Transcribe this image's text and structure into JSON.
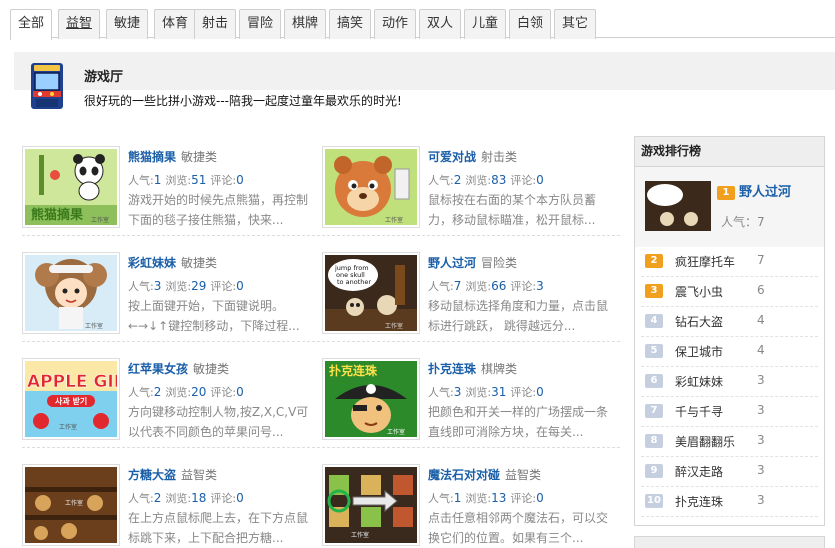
{
  "tabs": [
    {
      "label": "全部",
      "active": true
    },
    {
      "label": "益智",
      "underline": true
    },
    {
      "label": "敏捷"
    },
    {
      "label": "体育"
    },
    {
      "label": "射击"
    },
    {
      "label": "冒险"
    },
    {
      "label": "棋牌"
    },
    {
      "label": "搞笑"
    },
    {
      "label": "动作"
    },
    {
      "label": "双人"
    },
    {
      "label": "儿童"
    },
    {
      "label": "白领"
    },
    {
      "label": "其它"
    }
  ],
  "header": {
    "title": "游戏厅",
    "description": "很好玩的一些比拼小游戏---陪我一起度过童年最欢乐的时光!",
    "icon": "arcade-machine-icon"
  },
  "stat_labels": {
    "popularity": "人气:",
    "rating": "浏览:",
    "comments": "评论:"
  },
  "games": [
    {
      "title": "熊猫摘果",
      "category": "敏捷类",
      "popularity": "1",
      "rating": "51",
      "comments": "0",
      "desc": "游戏开始的时候先点熊猫，再控制下面的毯子接住熊猫，快来..."
    },
    {
      "title": "可爱对战",
      "category": "射击类",
      "popularity": "2",
      "rating": "83",
      "comments": "0",
      "desc": "鼠标按在右面的某个本方队员蓄力，移动鼠标瞄准，松开鼠标..."
    },
    {
      "title": "彩虹妹妹",
      "category": "敏捷类",
      "popularity": "3",
      "rating": "29",
      "comments": "0",
      "desc": "按上面键开始，下面键说明。←→↓↑键控制移动，下降过程..."
    },
    {
      "title": "野人过河",
      "category": "冒险类",
      "popularity": "7",
      "rating": "66",
      "comments": "3",
      "desc": "移动鼠标选择角度和力量，点击鼠标进行跳跃， 跳得越远分..."
    },
    {
      "title": "红苹果女孩",
      "category": "敏捷类",
      "popularity": "2",
      "rating": "20",
      "comments": "0",
      "desc": "方向键移动控制人物,按Z,X,C,V可以代表不同颜色的苹果问号..."
    },
    {
      "title": "扑克连珠",
      "category": "棋牌类",
      "popularity": "3",
      "rating": "31",
      "comments": "0",
      "desc": "把颜色和开关一样的广场摆成一条直线即可消除方块，在每关..."
    },
    {
      "title": "方糖大盗",
      "category": "益智类",
      "popularity": "2",
      "rating": "18",
      "comments": "0",
      "desc": "在上方点鼠标爬上去，在下方点鼠标跳下来，上下配合把方糖..."
    },
    {
      "title": "魔法石对对碰",
      "category": "益智类",
      "popularity": "1",
      "rating": "13",
      "comments": "0",
      "desc": "点击任意相邻两个魔法石，可以交换它们的位置。如果有三个..."
    }
  ],
  "thumb_texts": {
    "panda": "熊猫摘果",
    "skull": "jump from one skull to another",
    "apple": "APPLE GIRL",
    "apple_sub": "사과 받기",
    "poker": "扑克连珠",
    "studio": "工作室"
  },
  "ranking": {
    "title": "游戏排行榜",
    "popularity_label": "人气：",
    "first": {
      "rank": "1",
      "name": "野人过河",
      "value": "7"
    },
    "items": [
      {
        "rank": "2",
        "name": "疯狂摩托车",
        "value": "7",
        "hot": true
      },
      {
        "rank": "3",
        "name": "震飞小虫",
        "value": "6",
        "hot": true
      },
      {
        "rank": "4",
        "name": "钻石大盗",
        "value": "4"
      },
      {
        "rank": "5",
        "name": "保卫城市",
        "value": "4"
      },
      {
        "rank": "6",
        "name": "彩虹妹妹",
        "value": "3"
      },
      {
        "rank": "7",
        "name": "千与千寻",
        "value": "3"
      },
      {
        "rank": "8",
        "name": "美眉翻翻乐",
        "value": "3"
      },
      {
        "rank": "9",
        "name": "醉汉走路",
        "value": "3"
      },
      {
        "rank": "10",
        "name": "扑克连珠",
        "value": "3"
      }
    ]
  },
  "colors": {
    "link": "#1a5fa8",
    "hot_badge": "#f0a01e",
    "cold_badge": "#c5cfe0"
  }
}
